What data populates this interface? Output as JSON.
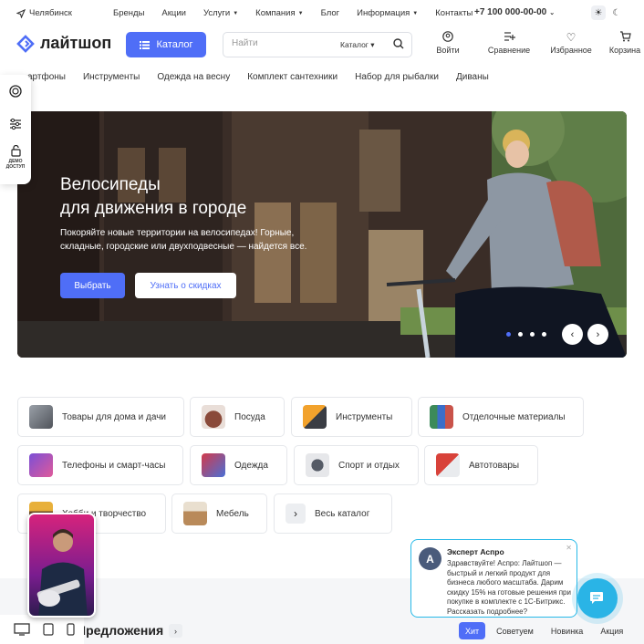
{
  "topbar": {
    "city": "Челябинск",
    "nav": [
      {
        "label": "Бренды",
        "dropdown": false
      },
      {
        "label": "Акции",
        "dropdown": false
      },
      {
        "label": "Услуги",
        "dropdown": true
      },
      {
        "label": "Компания",
        "dropdown": true
      },
      {
        "label": "Блог",
        "dropdown": false
      },
      {
        "label": "Информация",
        "dropdown": true
      },
      {
        "label": "Контакты",
        "dropdown": false
      }
    ],
    "phone": "+7 100 000-00-00"
  },
  "header": {
    "logo": "лайтшоп",
    "catalog_button": "Каталог",
    "search": {
      "placeholder": "Найти",
      "scope": "Каталог"
    },
    "actions": [
      "Войти",
      "Сравнение",
      "Избранное",
      "Корзина"
    ]
  },
  "subnav": [
    "артфоны",
    "Инструменты",
    "Одежда на весну",
    "Комплект сантехники",
    "Набор для рыбалки",
    "Диваны"
  ],
  "sidepanel": {
    "demo_label": "ДЕМО ДОСТУП"
  },
  "banner": {
    "title_line1": "Велосипеды",
    "title_line2": "для движения в городе",
    "text": "Покоряйте новые территории на велосипедах! Горные, складные, городские или двухподвесные — найдется все.",
    "primary_button": "Выбрать",
    "secondary_button": "Узнать о скидках",
    "slides": 4,
    "active_slide": 1
  },
  "categories": [
    {
      "label": "Товары для дома и дачи",
      "color": "#6b6f78"
    },
    {
      "label": "Посуда",
      "color": "#8a4a3a"
    },
    {
      "label": "Инструменты",
      "color": "#f2a22c"
    },
    {
      "label": "Отделочные материалы",
      "color": "#3c8a5a"
    },
    {
      "label": "Телефоны и смарт-часы",
      "color": "#7b4fd6"
    },
    {
      "label": "Одежда",
      "color": "#d33a4a"
    },
    {
      "label": "Спорт и отдых",
      "color": "#555b66"
    },
    {
      "label": "Автотовары",
      "color": "#d8423a"
    },
    {
      "label": "Хобби и творчество",
      "color": "#e8b03a"
    },
    {
      "label": "Мебель",
      "color": "#b98a5a"
    },
    {
      "label": "Весь каталог",
      "color": "#eceef1"
    }
  ],
  "section": {
    "title": "Предложения",
    "tabs": [
      "Хит",
      "Советуем",
      "Новинка",
      "Акция"
    ],
    "active_tab": "Хит"
  },
  "chat": {
    "avatar": "A",
    "name": "Эксперт Аспро",
    "message": "Здравствуйте! Аспро: Лайтшоп — быстрый и легкий продукт для бизнеса любого масштаба. Дарим скидку 15% на готовые решения при покупке в комплекте с 1С-Битрикс. Рассказать подробнее?"
  },
  "colors": {
    "accent": "#4f6ef7",
    "chat": "#2ab4e6"
  }
}
